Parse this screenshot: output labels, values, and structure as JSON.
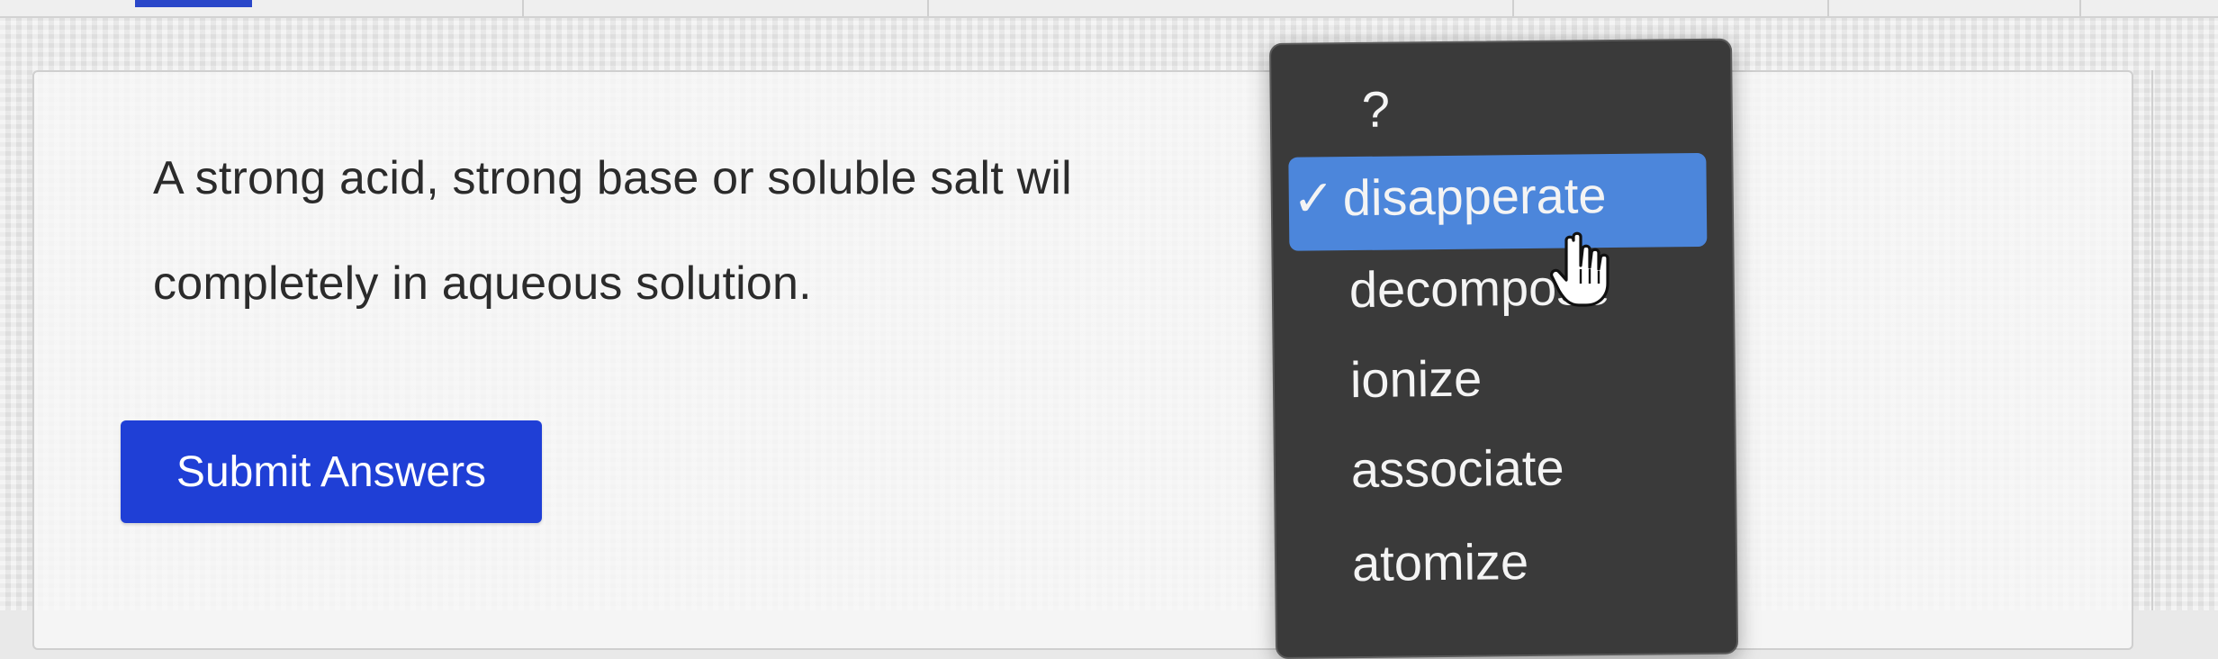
{
  "question": {
    "line1": "A strong acid, strong base or soluble salt wil",
    "line2": "completely in aqueous solution."
  },
  "submit_label": "Submit Answers",
  "dropdown": {
    "placeholder": "?",
    "check_mark": "✓",
    "selected": "disapperate",
    "options": [
      "disapperate",
      "decompose",
      "ionize",
      "associate",
      "atomize"
    ]
  },
  "colors": {
    "submit_button": "#1f3fd6",
    "dropdown_bg": "#3a3a3a",
    "highlight": "#4c86db",
    "text": "#2b2b2b"
  },
  "icons": {
    "cursor": "hand-pointer-icon",
    "check": "checkmark-icon"
  }
}
